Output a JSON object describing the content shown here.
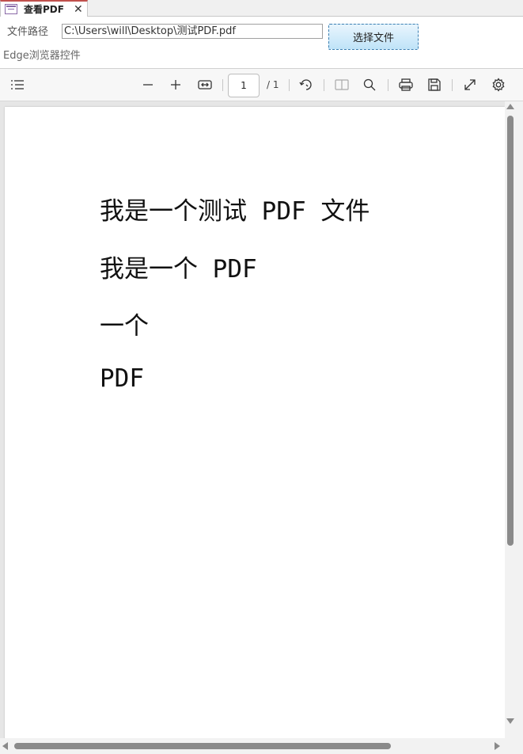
{
  "tab": {
    "title": "查看PDF",
    "close_glyph": "✕",
    "icon": "form-icon"
  },
  "form": {
    "path_label": "文件路径",
    "path_value": "C:\\Users\\will\\Desktop\\测试PDF.pdf",
    "choose_button": "选择文件",
    "control_label": "Edge浏览器控件"
  },
  "toolbar": {
    "icons": [
      "contents-icon",
      "zoom-out-icon",
      "zoom-in-icon",
      "fit-width-icon",
      "rotate-icon",
      "page-view-icon",
      "search-icon",
      "print-icon",
      "save-icon",
      "fullscreen-icon",
      "settings-icon"
    ],
    "page_current": "1",
    "page_total": "/ 1"
  },
  "document": {
    "lines": [
      "我是一个测试 PDF 文件",
      "我是一个 PDF",
      "一个",
      "PDF"
    ]
  },
  "colors": {
    "tab_accent": "#c0504d",
    "button_bg": "#bfe3f8",
    "button_border": "#3c7fb1",
    "scroll_thumb": "#8a8a8a"
  }
}
